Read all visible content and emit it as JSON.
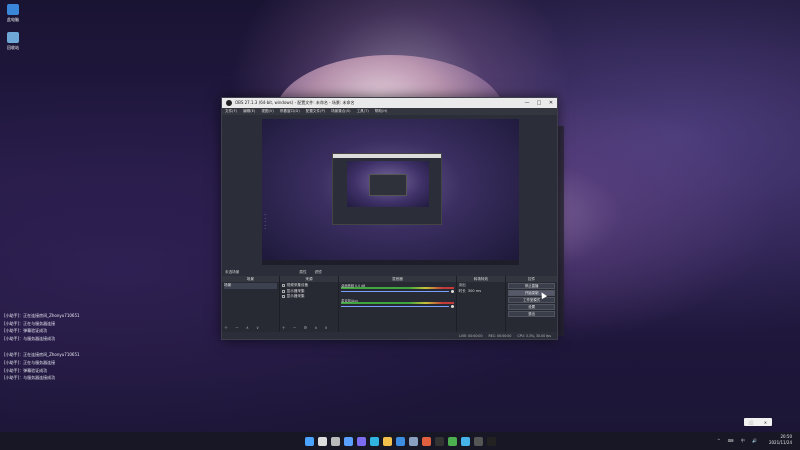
{
  "desktop": {
    "icons": [
      {
        "label": "此电脑",
        "icon": "computer-icon",
        "color": "#3a86d9"
      },
      {
        "label": "回收站",
        "icon": "recycle-bin-icon",
        "color": "#6fa8d6"
      }
    ],
    "log_lines": [
      "[小助手]：正在连接房间_Zhonyu710651",
      "[小助手]：正在与服务器连接",
      "[小助手]：弹幕验证成功",
      "[小助手]：与服务器连接成功",
      "",
      "[小助手]：正在连接房间_Zhonyu710651",
      "[小助手]：正在与服务器连接",
      "[小助手]：弹幕验证成功",
      "[小助手]：与服务器连接成功"
    ]
  },
  "obs": {
    "title": "OBS 27.1.3 (64-bit, windows) - 配置文件: 未命名 - 场景: 未命名",
    "window_controls": [
      "—",
      "□",
      "✕"
    ],
    "menu": [
      "文件(F)",
      "编辑(E)",
      "视图(V)",
      "停靠窗口(D)",
      "配置文件(P)",
      "场景集合(S)",
      "工具(T)",
      "帮助(H)"
    ],
    "preview_text": [
      "...",
      "...",
      "...",
      "...",
      "..."
    ],
    "scene_bar": {
      "label": "未选场景",
      "tool1": "属性",
      "tool2": "滤镜"
    },
    "docks": {
      "scenes": {
        "header": "场景",
        "items": [
          "场景"
        ]
      },
      "sources": {
        "header": "来源",
        "items": [
          "视频采集设备",
          "显示器采集",
          "显示器采集"
        ]
      },
      "mixer": {
        "header": "混音器",
        "tracks": [
          {
            "name": "桌面音频 0.0 dB"
          },
          {
            "name": "麦克风/Aux"
          }
        ]
      },
      "transitions": {
        "header": "转场特效",
        "type": "淡出",
        "duration_label": "时长",
        "duration": "300 ms"
      },
      "controls": {
        "header": "控件",
        "buttons": [
          "停止直播",
          "开始录制",
          "工作室模式",
          "设置",
          "退出"
        ]
      }
    },
    "status": [
      "LIVE: 00:00:00",
      "REC: 00:00:00",
      "CPU: 3.3%, 30.00 fps"
    ]
  },
  "taskbar": {
    "icons": [
      {
        "name": "start-icon",
        "color": "#4aa3ff"
      },
      {
        "name": "search-icon",
        "color": "#dddddd"
      },
      {
        "name": "task-view-icon",
        "color": "#bbbbbb"
      },
      {
        "name": "widgets-icon",
        "color": "#5aa0ff"
      },
      {
        "name": "chat-icon",
        "color": "#7b6cf0"
      },
      {
        "name": "edge-icon",
        "color": "#2fb5e0"
      },
      {
        "name": "explorer-icon",
        "color": "#f2c14b"
      },
      {
        "name": "store-icon",
        "color": "#3d8ee0"
      },
      {
        "name": "steam-icon",
        "color": "#8aa0c0"
      },
      {
        "name": "app-icon",
        "color": "#e06040"
      },
      {
        "name": "game-icon",
        "color": "#333333"
      },
      {
        "name": "chrome-icon",
        "color": "#4caf50"
      },
      {
        "name": "bilibili-icon",
        "color": "#46b4e8"
      },
      {
        "name": "terminal-icon",
        "color": "#555555"
      },
      {
        "name": "obs-icon",
        "color": "#222222"
      }
    ],
    "tray_symbols": "^ ⌨ 中 🔊",
    "time": "20:50",
    "date": "2021/11/24"
  },
  "popup": {
    "left": "⬜",
    "right": "✕"
  }
}
